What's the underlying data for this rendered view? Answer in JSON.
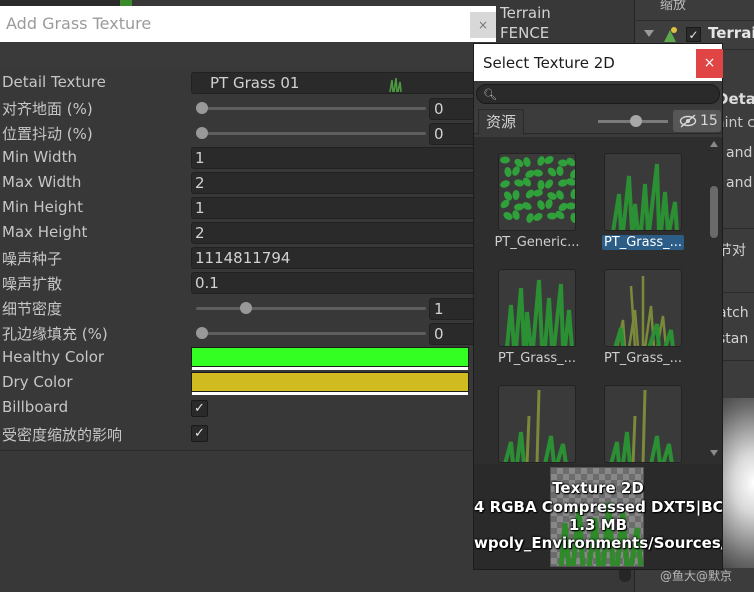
{
  "background": {
    "hierarchy_items": [
      "Terrain",
      "FENCE"
    ],
    "inspector_header": "缩放",
    "inspector_terrain_label": "Terrain",
    "inspector_texts": {
      "detail": "Detail",
      "paint": "aint c",
      "and1": "and",
      "and2": "and",
      "jie": "节对",
      "atch": "atch",
      "stan": "stan"
    },
    "watermark": "@鱼大@默京"
  },
  "grass_window": {
    "title": "Add Grass Texture",
    "close_label": "×",
    "detail_texture": {
      "label": "Detail Texture",
      "value": "PT Grass 01"
    },
    "align_ground": {
      "label": "对齐地面 (%)",
      "value": "0",
      "fraction": 0
    },
    "position_jitter": {
      "label": "位置抖动 (%)",
      "value": "0",
      "fraction": 0
    },
    "min_width": {
      "label": "Min Width",
      "value": "1"
    },
    "max_width": {
      "label": "Max Width",
      "value": "2"
    },
    "min_height": {
      "label": "Min Height",
      "value": "1"
    },
    "max_height": {
      "label": "Max Height",
      "value": "2"
    },
    "noise_seed": {
      "label": "噪声种子",
      "value": "1114811794"
    },
    "noise_spread": {
      "label": "噪声扩散",
      "value": "0.1"
    },
    "detail_density": {
      "label": "细节密度",
      "value": "1",
      "fraction": 0.2
    },
    "hole_edge_padding": {
      "label": "孔边缘填充 (%)",
      "value": "0",
      "fraction": 0
    },
    "healthy_color": {
      "label": "Healthy Color",
      "color": "#33ff22"
    },
    "dry_color": {
      "label": "Dry Color",
      "color": "#d0bb20"
    },
    "billboard": {
      "label": "Billboard",
      "checked": true,
      "mark": "✓"
    },
    "density_scale": {
      "label": "受密度缩放的影响",
      "checked": true,
      "mark": "✓"
    }
  },
  "select_window": {
    "title": "Select Texture 2D",
    "close_label": "×",
    "search": {
      "value": "",
      "icon": "search-icon"
    },
    "tab_assets": "资源",
    "hidden_count": "15",
    "thumbnails": [
      {
        "label": "PT_Generic...",
        "selected": false,
        "kind": "leaves"
      },
      {
        "label": "PT_Grass_...",
        "selected": true,
        "kind": "grass"
      },
      {
        "label": "PT_Grass_...",
        "selected": false,
        "kind": "grass-tall"
      },
      {
        "label": "PT_Grass_...",
        "selected": false,
        "kind": "grass-seed"
      },
      {
        "label": "",
        "selected": false,
        "kind": "grass-spike"
      },
      {
        "label": "",
        "selected": false,
        "kind": "grass-spike"
      }
    ],
    "info": {
      "line1": "Texture 2D",
      "line2": "4  RGBA Compressed DXT5|BC",
      "line3": "1.3 MB",
      "line4": "wpoly_Environments/Sources/"
    }
  },
  "accent_colors": {
    "selection": "#2c5d87",
    "close_red": "#e04444",
    "grass_green": "#3a9a36"
  }
}
